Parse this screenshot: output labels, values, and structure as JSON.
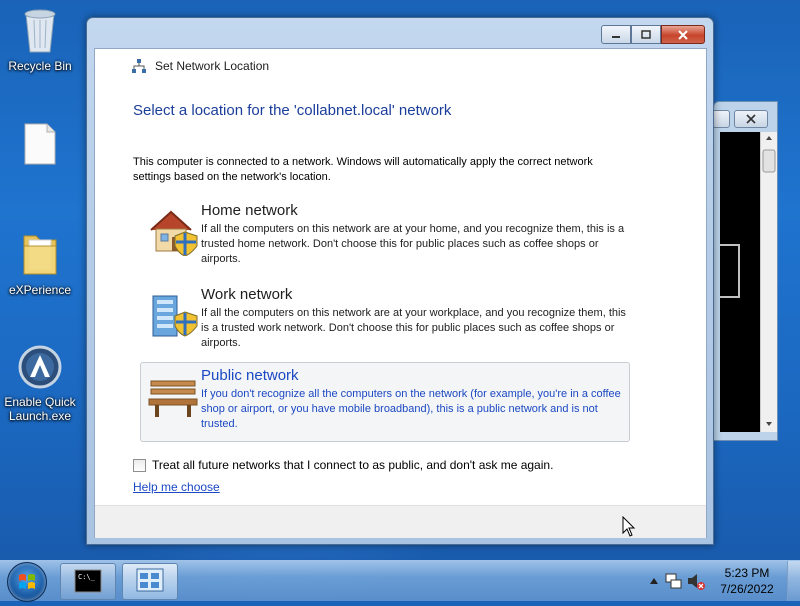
{
  "desktop": {
    "icons": [
      {
        "label": "Recycle Bin"
      },
      {
        "label": ""
      },
      {
        "label": "eXPerience"
      },
      {
        "label": "Enable Quick\nLaunch.exe"
      }
    ]
  },
  "dialog": {
    "title": "Set Network Location",
    "heading": "Select a location for the 'collabnet.local' network",
    "intro": "This computer is connected to a network. Windows will automatically apply the correct network settings based on the network's location.",
    "options": [
      {
        "title": "Home network",
        "icon": "house-icon",
        "description": "If all the computers on this network are at your home, and you recognize them, this is a trusted home network.  Don't choose this for public places such as coffee shops or airports."
      },
      {
        "title": "Work network",
        "icon": "office-building-icon",
        "description": "If all the computers on this network are at your workplace, and you recognize them, this is a trusted work network.  Don't choose this for public places such as coffee shops or airports."
      },
      {
        "title": "Public network",
        "icon": "park-bench-icon",
        "selected": true,
        "description": "If you don't recognize all the computers on the network (for example, you're in a coffee shop or airport, or you have mobile broadband), this is a public network and is not trusted."
      }
    ],
    "checkbox_label": "Treat all future networks that I connect to as public, and don't ask me again.",
    "checkbox_checked": false,
    "help_link": "Help me choose"
  },
  "console_window": {
    "buttons": [
      "minimize",
      "close"
    ]
  },
  "taskbar": {
    "buttons": [
      "command-prompt",
      "network-settings"
    ],
    "clock_time": "5:23 PM",
    "clock_date": "7/26/2022"
  },
  "colors": {
    "link": "#1b49c4",
    "heading": "#1b3e9b",
    "desktop": "#1f74cf"
  }
}
